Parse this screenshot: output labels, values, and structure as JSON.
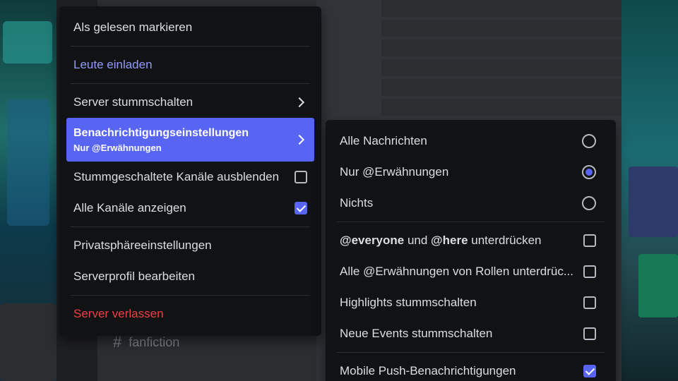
{
  "background": {
    "channel_name": "fanfiction",
    "channel_hash": "#"
  },
  "menu": {
    "items": [
      {
        "label": "Als gelesen markieren"
      },
      {
        "label": "Leute einladen"
      },
      {
        "label": "Server stummschalten"
      },
      {
        "label": "Benachrichtigungseinstellungen",
        "sub": "Nur @Erwähnungen"
      },
      {
        "label": "Stummgeschaltete Kanäle ausblenden",
        "checked": false
      },
      {
        "label": "Alle Kanäle anzeigen",
        "checked": true
      },
      {
        "label": "Privatsphäreeinstellungen"
      },
      {
        "label": "Serverprofil bearbeiten"
      },
      {
        "label": "Server verlassen"
      }
    ]
  },
  "submenu": {
    "items": [
      {
        "label": "Alle Nachrichten",
        "type": "radio",
        "selected": false
      },
      {
        "label": "Nur @Erwähnungen",
        "type": "radio",
        "selected": true
      },
      {
        "label": "Nichts",
        "type": "radio",
        "selected": false
      },
      {
        "mention1": "@everyone",
        "und": " und ",
        "mention2": "@here",
        "rest": " unterdrücken",
        "type": "checkbox",
        "checked": false
      },
      {
        "label": "Alle @Erwähnungen von Rollen unterdrüc...",
        "type": "checkbox",
        "checked": false
      },
      {
        "label": "Highlights stummschalten",
        "type": "checkbox",
        "checked": false
      },
      {
        "label": "Neue Events stummschalten",
        "type": "checkbox",
        "checked": false
      },
      {
        "label": "Mobile Push-Benachrichtigungen",
        "type": "checkbox",
        "checked": true
      }
    ]
  },
  "colors": {
    "accent": "#5865f2",
    "danger": "#f23f43",
    "link": "#949cf7",
    "menu_bg": "#111214"
  }
}
